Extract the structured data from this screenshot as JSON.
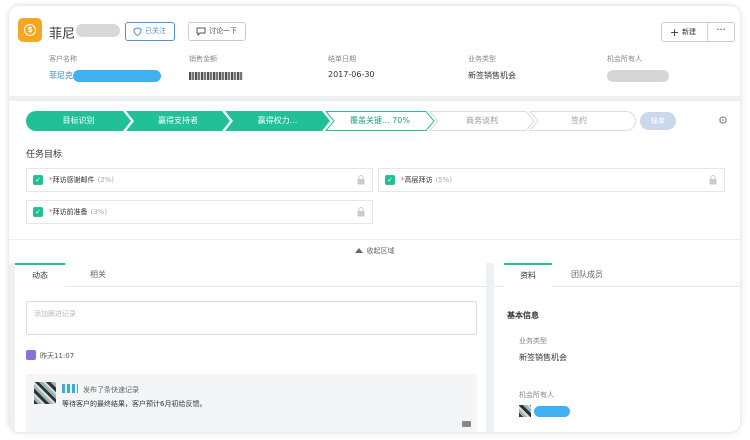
{
  "header": {
    "title": "菲尼",
    "follow_label": "已关注",
    "discuss_label": "讨论一下",
    "new_label": "新建",
    "more_label": "···"
  },
  "fields": [
    {
      "label": "客户名称",
      "value": "菲尼克"
    },
    {
      "label": "销售金额",
      "value": ""
    },
    {
      "label": "结单日期",
      "value": "2017-06-30"
    },
    {
      "label": "业务类型",
      "value": "新签销售机会"
    },
    {
      "label": "机会所有人",
      "value": ""
    }
  ],
  "stages": [
    {
      "label": "目标识别",
      "state": "done"
    },
    {
      "label": "赢得支持者",
      "state": "done"
    },
    {
      "label": "赢得权力...",
      "state": "done"
    },
    {
      "label": "覆盖关键... 70%",
      "state": "current"
    },
    {
      "label": "商务谈判",
      "state": "todo"
    },
    {
      "label": "签约",
      "state": "todo"
    }
  ],
  "stage_actions": {
    "lose_label": "输单"
  },
  "tasks": {
    "title": "任务目标",
    "items": [
      {
        "required": "*",
        "label": "拜访感谢邮件",
        "pct": "(2%)"
      },
      {
        "required": "*",
        "label": "高层拜访",
        "pct": "(5%)"
      },
      {
        "required": "*",
        "label": "拜访前准备",
        "pct": "(3%)"
      }
    ],
    "collapse_label": "收起区域"
  },
  "activity": {
    "tabs": [
      "动态",
      "相关"
    ],
    "input_placeholder": "添加跟进记录",
    "day": "昨天11:07",
    "item_meta": "发布了条快速记录",
    "item_text": "等待客户的最终结果，客户预计6月初给反馈。"
  },
  "info": {
    "tabs": [
      "资料",
      "团队成员"
    ],
    "section_title": "基本信息",
    "fields": [
      {
        "label": "业务类型",
        "value": "新签销售机会"
      },
      {
        "label": "机会所有人",
        "value": ""
      }
    ]
  },
  "colors": {
    "accent": "#20c197",
    "link": "#2d86c9",
    "brand": "#f5a623"
  }
}
